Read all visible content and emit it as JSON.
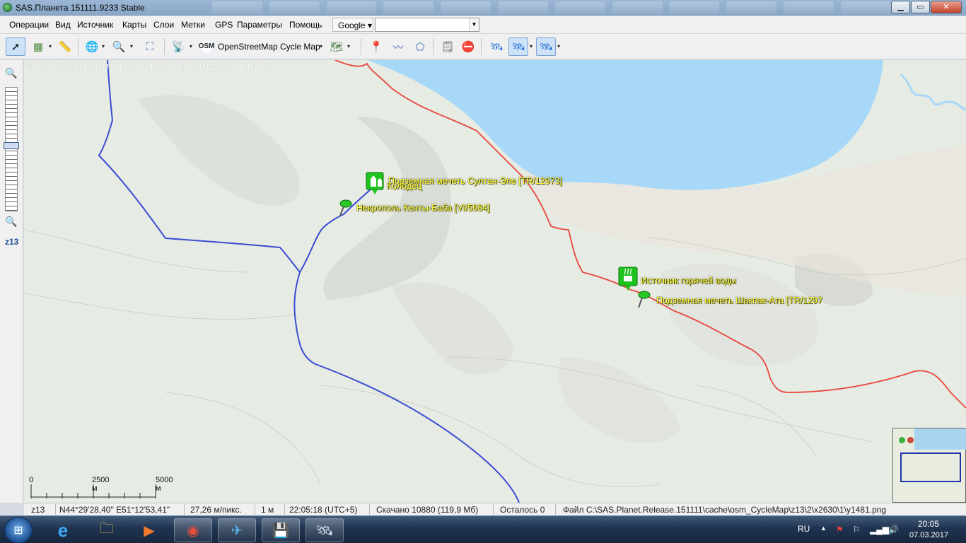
{
  "window": {
    "title": "SAS.Планета 151111.9233 Stable",
    "buttons": {
      "minimize": "▁",
      "maximize": "▭",
      "close": "✕"
    }
  },
  "menu": {
    "items": [
      "Операции",
      "Вид",
      "Источник",
      "Карты",
      "Слои",
      "Метки",
      "GPS",
      "Параметры",
      "Помощь"
    ],
    "search_provider": "Google ▾",
    "search_value": ""
  },
  "toolbar": {
    "map_source": "OpenStreetMap Cycle Map",
    "osm_logo": "OSM",
    "dropdown_arrow": "▾"
  },
  "zoom": {
    "level": "z13",
    "in_icon": "zoom-in-icon",
    "out_icon": "zoom-out-icon"
  },
  "map": {
    "attribution": "© OpenStreetMap contributors, CC-BY-SA. Tiles courtesy of Andy Allan.",
    "markers": [
      {
        "label": "Подземная мечеть Султан-Эпе [TR/12973]",
        "icon": "mosque-marker-icon"
      },
      {
        "label": "Колодец",
        "icon": "well-marker-icon"
      },
      {
        "label": "Некрополь Кенты-Баба [VI/5684]",
        "icon": "pushpin-icon"
      },
      {
        "label": "Источник горячей воды",
        "icon": "hot-spring-marker-icon"
      },
      {
        "label": "Подземная мечеть Шакпак-Ата [TR/1297",
        "icon": "pushpin-icon"
      }
    ],
    "scale": {
      "zero": "0",
      "mid": "2500 м",
      "max": "5000 м"
    },
    "colors": {
      "sea": "#a8d8f8",
      "track": "#3b4cd4",
      "road": "#e8473d",
      "land": "#e6ebe3"
    }
  },
  "status": {
    "zoom": "z13",
    "coords": "N44°29'28,40\" E51°12'53,41\"",
    "resolution": "27,26 м/пикс.",
    "distance": "1 м",
    "time": "22:05:18 (UTC+5)",
    "downloaded": "Скачано 10880 (119,9 Мб)",
    "remaining": "Осталось 0",
    "file": "Файл C:\\SAS.Planet.Release.151111\\cache\\osm_CycleMap\\z13\\2\\x2630\\1\\y1481.png"
  },
  "taskbar": {
    "apps": [
      "internet-explorer-icon",
      "file-explorer-icon",
      "media-player-icon",
      "chrome-icon",
      "telegram-icon",
      "floppy-app-icon",
      "sas-planet-icon"
    ],
    "lang": "RU",
    "clock_time": "20:05",
    "clock_date": "07.03.2017"
  }
}
